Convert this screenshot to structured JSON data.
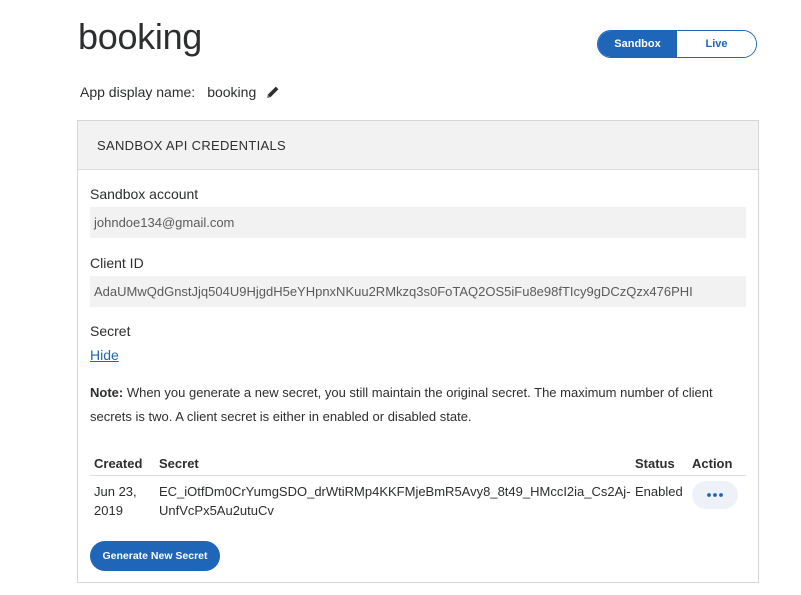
{
  "app": {
    "title": "booking"
  },
  "env_toggle": {
    "sandbox_label": "Sandbox",
    "live_label": "Live",
    "selected": "Sandbox"
  },
  "display_name": {
    "label": "App display name:",
    "value": "booking",
    "edit_icon": "pencil-icon"
  },
  "credentials": {
    "header": "SANDBOX API CREDENTIALS",
    "sandbox_account_label": "Sandbox account",
    "sandbox_account_value": "johndoe134@gmail.com",
    "client_id_label": "Client ID",
    "client_id_value": "AdaUMwQdGnstJjq504U9HjgdH5eYHpnxNKuu2RMkzq3s0FoTAQ2OS5iFu8e98fTIcy9gDCzQzx476PHI",
    "secret_label": "Secret",
    "hide_link": "Hide",
    "note_bold": "Note:",
    "note_text": " When you generate a new secret, you still maintain the original secret. The maximum number of client secrets is two. A client secret is either in enabled or disabled state.",
    "table": {
      "headers": [
        "Created",
        "Secret",
        "Status",
        "Action"
      ],
      "rows": [
        {
          "created": "Jun 23, 2019",
          "secret": "EC_iOtfDm0CrYumgSDO_drWtiRMp4KKFMjeBmR5Avy8_8t49_HMccI2ia_Cs2Aj-UnfVcPx5Au2utuCv",
          "status": "Enabled",
          "action_icon": "more-dots-icon"
        }
      ]
    },
    "generate_button": "Generate New Secret"
  },
  "colors": {
    "accent": "#1f66b8",
    "panel_bg": "#f2f2f2"
  }
}
